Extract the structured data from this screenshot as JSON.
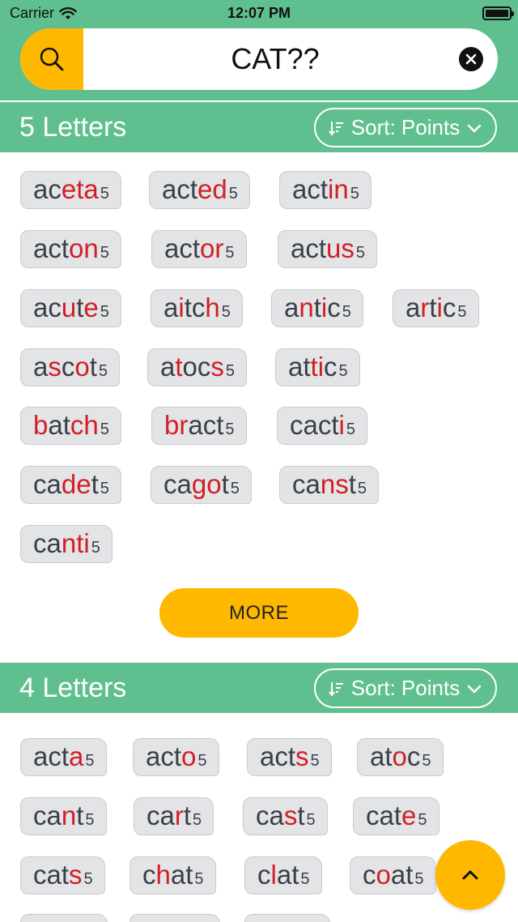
{
  "status": {
    "carrier": "Carrier",
    "time": "12:07 PM"
  },
  "search": {
    "value": "CAT??",
    "icon": "search-icon",
    "clear_icon": "close-icon"
  },
  "colors": {
    "header": "#5fbf8f",
    "accent": "#ffb800",
    "highlight": "#d21f26"
  },
  "sections": [
    {
      "title": "5 Letters",
      "sort_label": "Sort: Points",
      "words": [
        {
          "parts": [
            {
              "t": "ac"
            },
            {
              "t": "eta",
              "r": true
            }
          ],
          "points": "5"
        },
        {
          "parts": [
            {
              "t": "act"
            },
            {
              "t": "ed",
              "r": true
            }
          ],
          "points": "5"
        },
        {
          "parts": [
            {
              "t": "act"
            },
            {
              "t": "in",
              "r": true
            }
          ],
          "points": "5"
        },
        {
          "parts": [
            {
              "t": "act"
            },
            {
              "t": "on",
              "r": true
            }
          ],
          "points": "5"
        },
        {
          "parts": [
            {
              "t": "act"
            },
            {
              "t": "or",
              "r": true
            }
          ],
          "points": "5"
        },
        {
          "parts": [
            {
              "t": "act"
            },
            {
              "t": "us",
              "r": true
            }
          ],
          "points": "5"
        },
        {
          "parts": [
            {
              "t": "ac"
            },
            {
              "t": "u",
              "r": true
            },
            {
              "t": "t"
            },
            {
              "t": "e",
              "r": true
            }
          ],
          "points": "5"
        },
        {
          "parts": [
            {
              "t": "a"
            },
            {
              "t": "i",
              "r": true
            },
            {
              "t": "tc"
            },
            {
              "t": "h",
              "r": true
            }
          ],
          "points": "5"
        },
        {
          "parts": [
            {
              "t": "a"
            },
            {
              "t": "n",
              "r": true
            },
            {
              "t": "t"
            },
            {
              "t": "i",
              "r": true
            },
            {
              "t": "c"
            }
          ],
          "points": "5"
        },
        {
          "parts": [
            {
              "t": "a"
            },
            {
              "t": "r",
              "r": true
            },
            {
              "t": "t"
            },
            {
              "t": "i",
              "r": true
            },
            {
              "t": "c"
            }
          ],
          "points": "5"
        },
        {
          "parts": [
            {
              "t": "a"
            },
            {
              "t": "s",
              "r": true
            },
            {
              "t": "c"
            },
            {
              "t": "o",
              "r": true
            },
            {
              "t": "t"
            }
          ],
          "points": "5"
        },
        {
          "parts": [
            {
              "t": "a"
            },
            {
              "t": "t",
              "r": true
            },
            {
              "t": "oc"
            },
            {
              "t": "s",
              "r": true
            }
          ],
          "points": "5"
        },
        {
          "parts": [
            {
              "t": "at"
            },
            {
              "t": "ti",
              "r": true
            },
            {
              "t": "c"
            }
          ],
          "points": "5"
        },
        {
          "parts": [
            {
              "t": "b",
              "r": true
            },
            {
              "t": "at"
            },
            {
              "t": "ch",
              "r": true
            }
          ],
          "points": "5"
        },
        {
          "parts": [
            {
              "t": "br",
              "r": true
            },
            {
              "t": "act"
            }
          ],
          "points": "5"
        },
        {
          "parts": [
            {
              "t": "cact"
            },
            {
              "t": "i",
              "r": true
            }
          ],
          "points": "5"
        },
        {
          "parts": [
            {
              "t": "ca"
            },
            {
              "t": "de",
              "r": true
            },
            {
              "t": "t"
            }
          ],
          "points": "5"
        },
        {
          "parts": [
            {
              "t": "ca"
            },
            {
              "t": "go",
              "r": true
            },
            {
              "t": "t"
            }
          ],
          "points": "5"
        },
        {
          "parts": [
            {
              "t": "ca"
            },
            {
              "t": "ns",
              "r": true
            },
            {
              "t": "t"
            }
          ],
          "points": "5"
        },
        {
          "parts": [
            {
              "t": "ca"
            },
            {
              "t": "nti",
              "r": true
            }
          ],
          "points": "5"
        }
      ],
      "more_label": "MORE"
    },
    {
      "title": "4 Letters",
      "sort_label": "Sort: Points",
      "words": [
        {
          "parts": [
            {
              "t": "act"
            },
            {
              "t": "a",
              "r": true
            }
          ],
          "points": "5"
        },
        {
          "parts": [
            {
              "t": "act"
            },
            {
              "t": "o",
              "r": true
            }
          ],
          "points": "5"
        },
        {
          "parts": [
            {
              "t": "act"
            },
            {
              "t": "s",
              "r": true
            }
          ],
          "points": "5"
        },
        {
          "parts": [
            {
              "t": "at"
            },
            {
              "t": "o",
              "r": true
            },
            {
              "t": "c"
            }
          ],
          "points": "5"
        },
        {
          "parts": [
            {
              "t": "ca"
            },
            {
              "t": "n",
              "r": true
            },
            {
              "t": "t"
            }
          ],
          "points": "5"
        },
        {
          "parts": [
            {
              "t": "ca"
            },
            {
              "t": "r",
              "r": true
            },
            {
              "t": "t"
            }
          ],
          "points": "5"
        },
        {
          "parts": [
            {
              "t": "ca"
            },
            {
              "t": "s",
              "r": true
            },
            {
              "t": "t"
            }
          ],
          "points": "5"
        },
        {
          "parts": [
            {
              "t": "cat"
            },
            {
              "t": "e",
              "r": true
            }
          ],
          "points": "5"
        },
        {
          "parts": [
            {
              "t": "cat"
            },
            {
              "t": "s",
              "r": true
            }
          ],
          "points": "5"
        },
        {
          "parts": [
            {
              "t": "c"
            },
            {
              "t": "h",
              "r": true
            },
            {
              "t": "at"
            }
          ],
          "points": "5"
        },
        {
          "parts": [
            {
              "t": "c"
            },
            {
              "t": "l",
              "r": true
            },
            {
              "t": "at"
            }
          ],
          "points": "5"
        },
        {
          "parts": [
            {
              "t": "c"
            },
            {
              "t": "o",
              "r": true
            },
            {
              "t": "at"
            }
          ],
          "points": "5"
        }
      ]
    }
  ],
  "scroll_top_icon": "chevron-up-icon"
}
